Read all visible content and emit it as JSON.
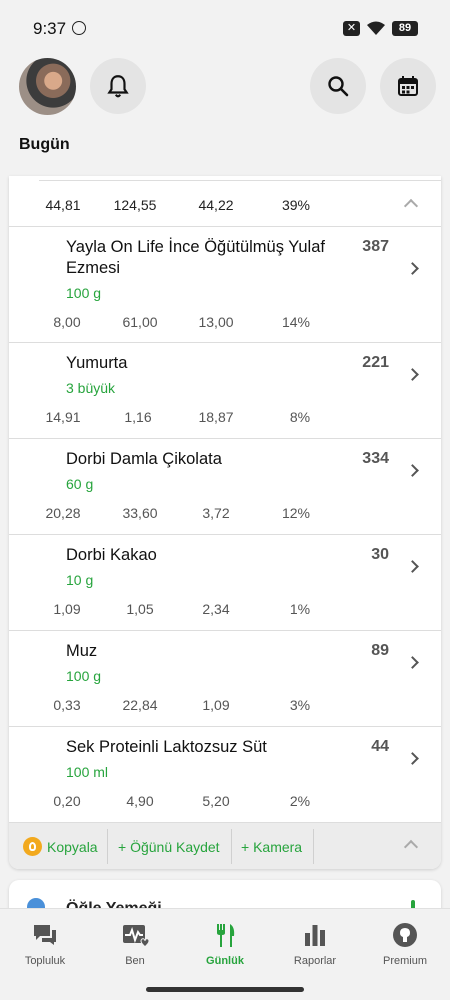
{
  "status_bar": {
    "time": "9:37",
    "battery": "89"
  },
  "header": {
    "title": "Bugün",
    "avatar_icon": "avatar",
    "notification_icon": "bell-icon",
    "search_icon": "search-icon",
    "calendar_icon": "calendar-icon"
  },
  "meal": {
    "summary": [
      "44,81",
      "124,55",
      "44,22",
      "39%"
    ],
    "foods": [
      {
        "name": "Yayla On Life İnce Öğütülmüş Yulaf Ezmesi",
        "quantity": "100 g",
        "calories": "387",
        "macros": [
          "8,00",
          "61,00",
          "13,00",
          "14%"
        ]
      },
      {
        "name": "Yumurta",
        "quantity": "3 büyük",
        "calories": "221",
        "macros": [
          "14,91",
          "1,16",
          "18,87",
          "8%"
        ]
      },
      {
        "name": "Dorbi Damla Çikolata",
        "quantity": "60 g",
        "calories": "334",
        "macros": [
          "20,28",
          "33,60",
          "3,72",
          "12%"
        ]
      },
      {
        "name": "Dorbi Kakao",
        "quantity": "10 g",
        "calories": "30",
        "macros": [
          "1,09",
          "1,05",
          "2,34",
          "1%"
        ]
      },
      {
        "name": "Muz",
        "quantity": "100 g",
        "calories": "89",
        "macros": [
          "0,33",
          "22,84",
          "1,09",
          "3%"
        ]
      },
      {
        "name": "Sek Proteinli Laktozsuz Süt",
        "quantity": "100 ml",
        "calories": "44",
        "macros": [
          "0,20",
          "4,90",
          "5,20",
          "2%"
        ]
      }
    ],
    "actions": {
      "copy": "Kopyala",
      "save_meal": "+ Öğünü Kaydet",
      "camera": "+ Kamera"
    }
  },
  "next_meal": {
    "label": "Öğle Yemeği"
  },
  "bottom_nav": {
    "items": [
      {
        "label": "Topluluk",
        "icon": "chat-icon"
      },
      {
        "label": "Ben",
        "icon": "heartbeat-icon"
      },
      {
        "label": "Günlük",
        "icon": "fork-knife-icon",
        "active": true
      },
      {
        "label": "Raporlar",
        "icon": "bar-chart-icon"
      },
      {
        "label": "Premium",
        "icon": "premium-icon"
      }
    ]
  },
  "colors": {
    "accent_green": "#27a43d",
    "coin_orange": "#f2a91e"
  }
}
